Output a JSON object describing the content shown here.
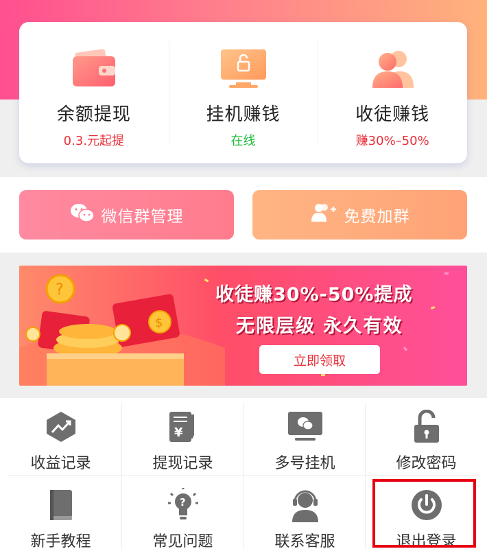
{
  "stats": [
    {
      "icon": "wallet-icon",
      "title": "余额提现",
      "sub": "0.3.元起提",
      "sub_color": "#e8303a"
    },
    {
      "icon": "monitor-lock-icon",
      "title": "挂机赚钱",
      "sub": "在线",
      "sub_color": "#1dbb3a"
    },
    {
      "icon": "users-icon",
      "title": "收徒赚钱",
      "sub": "赚30%–50%",
      "sub_color": "#e8303a"
    }
  ],
  "actions": {
    "wechat_group": "微信群管理",
    "free_join": "免费加群"
  },
  "banner": {
    "line1": "收徒赚30%-50%提成",
    "line2": "无限层级  永久有效",
    "button": "立即领取"
  },
  "grid": [
    {
      "icon": "earnings-chart-icon",
      "label": "收益记录"
    },
    {
      "icon": "withdraw-receipt-icon",
      "label": "提现记录"
    },
    {
      "icon": "wechat-monitor-icon",
      "label": "多号挂机"
    },
    {
      "icon": "unlock-icon",
      "label": "修改密码"
    },
    {
      "icon": "book-icon",
      "label": "新手教程"
    },
    {
      "icon": "lightbulb-question-icon",
      "label": "常见问题"
    },
    {
      "icon": "headset-agent-icon",
      "label": "联系客服"
    },
    {
      "icon": "power-icon",
      "label": "退出登录"
    }
  ],
  "colors": {
    "accent_pink": "#ff4f8f",
    "accent_orange": "#ffb27c",
    "highlight_red": "#e60012",
    "icon_gray": "#6e6e6e"
  }
}
